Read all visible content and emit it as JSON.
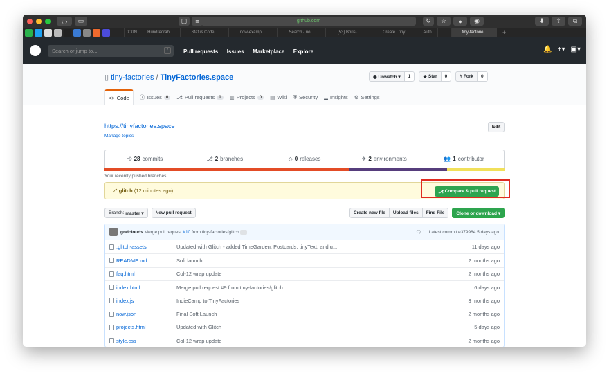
{
  "browser": {
    "url": "github.com",
    "tabs": [
      "XXIN",
      "Hundredrab...",
      "Status Code...",
      "now-exampl...",
      "Search - no...",
      "(53) Boris J...",
      "Create | tiny...",
      "Auth",
      "",
      "tiny-factorie..."
    ]
  },
  "header": {
    "search_placeholder": "Search or jump to...",
    "slash": "/",
    "nav": [
      "Pull requests",
      "Issues",
      "Marketplace",
      "Explore"
    ]
  },
  "repo": {
    "owner": "tiny-factories",
    "sep": " / ",
    "name": "TinyFactories.space",
    "watch": "Unwatch ▾",
    "watch_count": "1",
    "star": "Star",
    "star_count": "0",
    "fork": "Fork",
    "fork_count": "0",
    "tabs": [
      {
        "label": "Code",
        "count": ""
      },
      {
        "label": "Issues",
        "count": "0"
      },
      {
        "label": "Pull requests",
        "count": "0"
      },
      {
        "label": "Projects",
        "count": "0"
      },
      {
        "label": "Wiki",
        "count": ""
      },
      {
        "label": "Security",
        "count": ""
      },
      {
        "label": "Insights",
        "count": ""
      },
      {
        "label": "Settings",
        "count": ""
      }
    ],
    "website": "https://tinyfactories.space",
    "manage_topics": "Manage topics",
    "edit": "Edit"
  },
  "summary": {
    "commits_n": "28",
    "commits_l": "commits",
    "branches_n": "2",
    "branches_l": "branches",
    "releases_n": "0",
    "releases_l": "releases",
    "env_n": "2",
    "env_l": "environments",
    "contrib_n": "1",
    "contrib_l": "contributor"
  },
  "language_colors": [
    "#e34c26",
    "#563d7c",
    "#f1e05a"
  ],
  "pushed": {
    "label": "Your recently pushed branches:",
    "branch": "glitch",
    "time": "(12 minutes ago)",
    "button": "Compare & pull request"
  },
  "toolbar": {
    "branch_prefix": "Branch:",
    "branch": "master ▾",
    "new_pr": "New pull request",
    "create_file": "Create new file",
    "upload": "Upload files",
    "find": "Find File",
    "clone": "Clone or download ▾"
  },
  "commit": {
    "author": "gndclouds",
    "message": "Merge pull request",
    "pr": "#10",
    "rest": "from tiny-factories/glitch",
    "more": "...",
    "comments": "1",
    "latest": "Latest commit e379984 5 days ago"
  },
  "files": [
    {
      "name": ".glitch-assets",
      "msg": "Updated with Glitch - added TimeGarden, Postcards, tinyText, and u...",
      "age": "11 days ago"
    },
    {
      "name": "README.md",
      "msg": "Soft launch",
      "age": "2 months ago"
    },
    {
      "name": "faq.html",
      "msg": "Col-12 wrap update",
      "age": "2 months ago"
    },
    {
      "name": "index.html",
      "msg": "Merge pull request #9 from tiny-factories/glitch",
      "age": "6 days ago"
    },
    {
      "name": "index.js",
      "msg": "IndieCamp to TinyFactories",
      "age": "3 months ago"
    },
    {
      "name": "now.json",
      "msg": "Final Soft Launch",
      "age": "2 months ago"
    },
    {
      "name": "projects.html",
      "msg": "Updated with Glitch",
      "age": "5 days ago"
    },
    {
      "name": "style.css",
      "msg": "Col-12 wrap update",
      "age": "2 months ago"
    }
  ]
}
